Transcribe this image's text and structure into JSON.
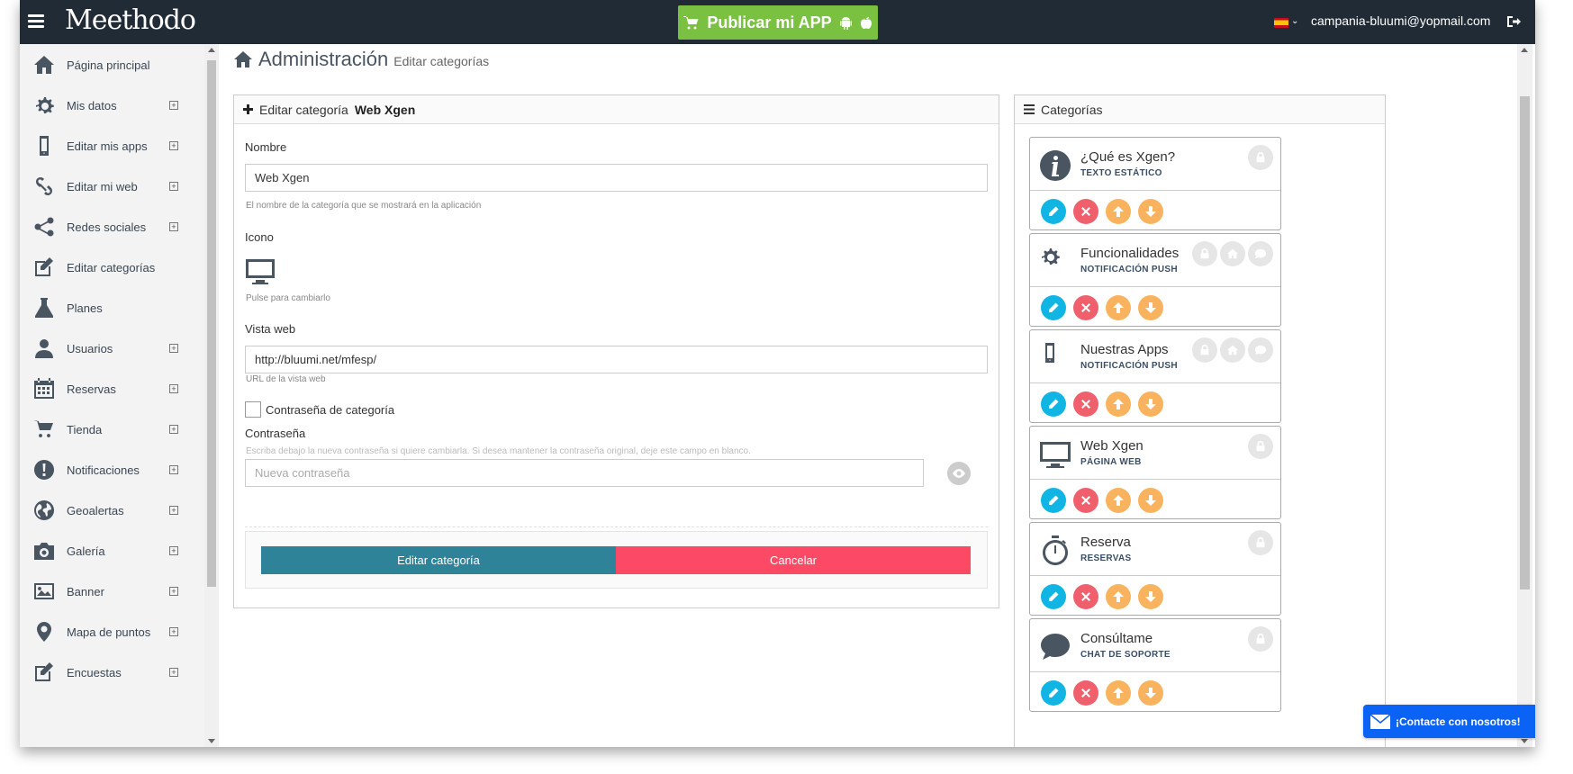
{
  "topbar": {
    "logo": "Meethodo",
    "publish_label": "Publicar mi APP",
    "user_email": "campania-bluumi@yopmail.com"
  },
  "sidebar": {
    "items": [
      {
        "label": "Página principal",
        "icon": "home-icon",
        "expandable": false
      },
      {
        "label": "Mis datos",
        "icon": "gear-icon",
        "expandable": true
      },
      {
        "label": "Editar mis apps",
        "icon": "mobile-icon",
        "expandable": true
      },
      {
        "label": "Editar mi web",
        "icon": "link-icon",
        "expandable": true
      },
      {
        "label": "Redes sociales",
        "icon": "share-icon",
        "expandable": true
      },
      {
        "label": "Editar categorías",
        "icon": "edit-icon",
        "expandable": false
      },
      {
        "label": "Planes",
        "icon": "flask-icon",
        "expandable": false
      },
      {
        "label": "Usuarios",
        "icon": "user-icon",
        "expandable": true
      },
      {
        "label": "Reservas",
        "icon": "calendar-icon",
        "expandable": true
      },
      {
        "label": "Tienda",
        "icon": "cart-icon",
        "expandable": true
      },
      {
        "label": "Notificaciones",
        "icon": "alert-icon",
        "expandable": true
      },
      {
        "label": "Geoalertas",
        "icon": "globe-icon",
        "expandable": true
      },
      {
        "label": "Galería",
        "icon": "camera-icon",
        "expandable": true
      },
      {
        "label": "Banner",
        "icon": "image-icon",
        "expandable": true
      },
      {
        "label": "Mapa de puntos",
        "icon": "map-marker-icon",
        "expandable": true
      },
      {
        "label": "Encuestas",
        "icon": "edit-icon",
        "expandable": true
      }
    ]
  },
  "header": {
    "title": "Administración",
    "subtitle": "Editar categorías"
  },
  "form": {
    "heading_prefix": "Editar categoría",
    "heading_name": "Web Xgen",
    "name_label": "Nombre",
    "name_value": "Web Xgen",
    "name_help": "El nombre de la categoría que se mostrará en la aplicación",
    "icon_label": "Icono",
    "icon_help": "Pulse para cambiarlo",
    "web_label": "Vista web",
    "web_value": "http://bluumi.net/mfesp/",
    "web_help": "URL de la vista web",
    "password_checkbox_label": "Contraseña de categoría",
    "password_label": "Contraseña",
    "password_help": "Escriba debajo la nueva contraseña si quiere cambiarla. Si desea mantener la contraseña original, deje este campo en blanco.",
    "password_placeholder": "Nueva contraseña",
    "edit_button": "Editar categoría",
    "cancel_button": "Cancelar"
  },
  "categories": {
    "heading": "Categorías",
    "items": [
      {
        "name": "¿Qué es Xgen?",
        "type": "TEXTO ESTÁTICO",
        "icon": "info-icon",
        "badges": [
          "lock-icon"
        ]
      },
      {
        "name": "Funcionalidades",
        "type": "NOTIFICACIÓN PUSH",
        "icon": "gear-icon",
        "badges": [
          "lock-icon",
          "home-icon",
          "chat-icon"
        ]
      },
      {
        "name": "Nuestras Apps",
        "type": "NOTIFICACIÓN PUSH",
        "icon": "mobile-icon",
        "badges": [
          "lock-icon",
          "home-icon",
          "chat-icon"
        ]
      },
      {
        "name": "Web Xgen",
        "type": "PÁGINA WEB",
        "icon": "monitor-icon",
        "badges": [
          "lock-icon"
        ]
      },
      {
        "name": "Reserva",
        "type": "RESERVAS",
        "icon": "stopwatch-icon",
        "badges": [
          "lock-icon"
        ]
      },
      {
        "name": "Consúltame",
        "type": "CHAT DE SOPORTE",
        "icon": "chat-icon",
        "badges": [
          "lock-icon"
        ]
      }
    ]
  },
  "contact": {
    "label": "¡Contacte con nosotros!"
  },
  "colors": {
    "topbar": "#202b36",
    "publish": "#7ac142",
    "edit_button": "#2e8399",
    "cancel_button": "#fc4a66",
    "action_edit": "#11b5e4",
    "action_delete": "#f0606c",
    "action_move": "#f9b35e",
    "contact": "#0b63f6"
  }
}
